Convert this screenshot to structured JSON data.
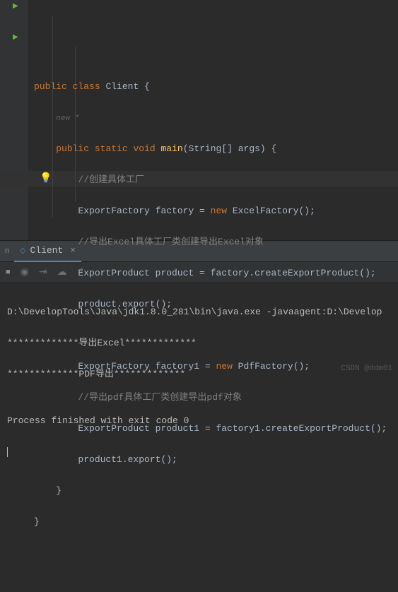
{
  "code": {
    "kw_public": "public",
    "kw_class": "class",
    "kw_static": "static",
    "kw_void": "void",
    "kw_new": "new",
    "class_name": "Client",
    "hint_new": "new *",
    "fn_main": "main",
    "main_params": "(String[] args) {",
    "cmt1": "//创建具体工厂",
    "line_factory": "ExportFactory factory = ",
    "excel_factory": " ExcelFactory();",
    "cmt2": "//导出Excel具体工厂类创建导出Excel对象",
    "line_product": "ExportProduct product = factory.createExportProduct();",
    "line_export": "product.export();",
    "line_factory1": "ExportFactory factory1 = ",
    "pdf_factory": " PdfFactory();",
    "cmt3": "//导出pdf具体工厂类创建导出pdf对象",
    "line_product1": "ExportProduct product1 = factory1.createExportProduct();",
    "line_export1": "product1.export();"
  },
  "tab": {
    "label": "Client",
    "side": "n"
  },
  "console": {
    "line1": "D:\\DevelopTools\\Java\\jdk1.8.0_281\\bin\\java.exe -javaagent:D:\\Develop",
    "line2": "*************导出Excel*************",
    "line3": "*************PDF导出*************",
    "line4": "Process finished with exit code 0"
  },
  "watermark": "CSDN @ddm01"
}
